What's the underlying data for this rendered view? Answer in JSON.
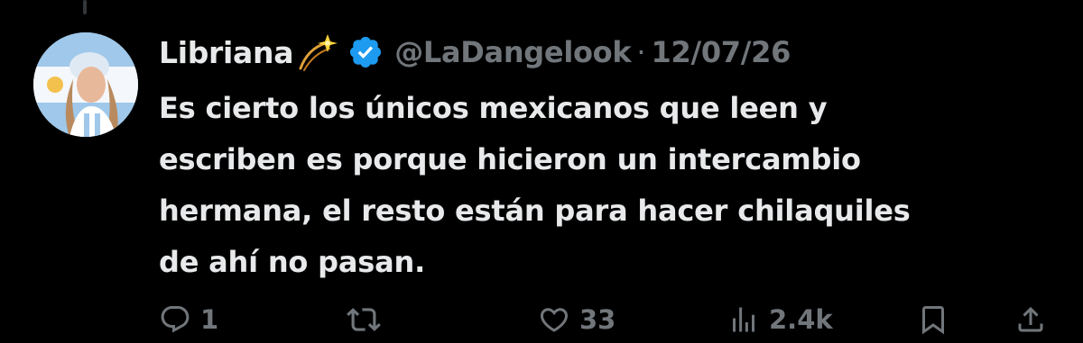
{
  "tweet": {
    "display_name": "Libriana",
    "name_emoji": "sparkle-icon",
    "verified": true,
    "verified_icon": "verified-badge-icon",
    "handle": "@LaDangelook",
    "separator": "·",
    "timestamp": "12/07/26",
    "text_lines": [
      "Es cierto los únicos mexicanos que leen y",
      "escriben es porque hicieron un intercambio",
      "hermana, el resto están para hacer chilaquiles",
      "de ahí no pasan."
    ]
  },
  "actions": {
    "reply": {
      "icon": "reply-icon",
      "count": "1"
    },
    "retweet": {
      "icon": "retweet-icon",
      "count": ""
    },
    "like": {
      "icon": "heart-icon",
      "count": "33"
    },
    "views": {
      "icon": "views-icon",
      "count": "2.4k"
    },
    "bookmark": {
      "icon": "bookmark-icon"
    },
    "share": {
      "icon": "share-icon"
    }
  },
  "colors": {
    "background": "#000000",
    "primary_text": "#e7e9ea",
    "secondary_text": "#71767b",
    "verified_blue": "#1d9bf0",
    "thread_line": "#333639"
  }
}
